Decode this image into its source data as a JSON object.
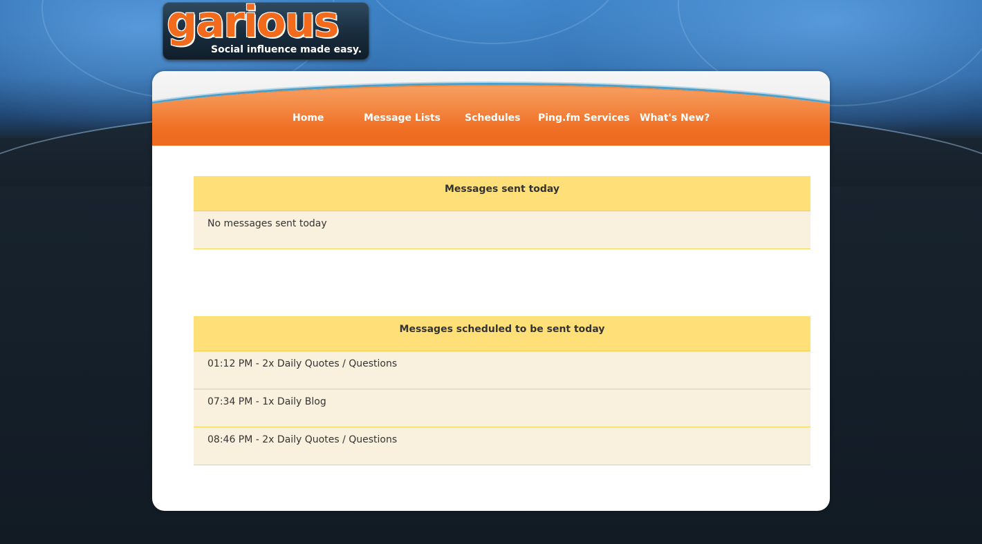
{
  "logo": {
    "word": "garious",
    "tagline": "Social influence made easy."
  },
  "nav": {
    "items": [
      {
        "label": "Home"
      },
      {
        "label": "Message Lists"
      },
      {
        "label": "Schedules"
      },
      {
        "label": "Ping.fm Services"
      },
      {
        "label": "What's New?"
      }
    ]
  },
  "sent_today": {
    "title": "Messages sent today",
    "rows": [
      "No messages sent today"
    ]
  },
  "scheduled_today": {
    "title": "Messages scheduled to be sent today",
    "rows": [
      "01:12 PM - 2x Daily Quotes / Questions",
      "07:34 PM - 1x Daily Blog",
      "08:46 PM - 2x Daily Quotes / Questions"
    ]
  },
  "colors": {
    "brand_orange": "#f26b1d",
    "header_yellow": "#ffdf78",
    "row_cream": "#f9f1dd",
    "background_blue": "#2f6fb2"
  }
}
